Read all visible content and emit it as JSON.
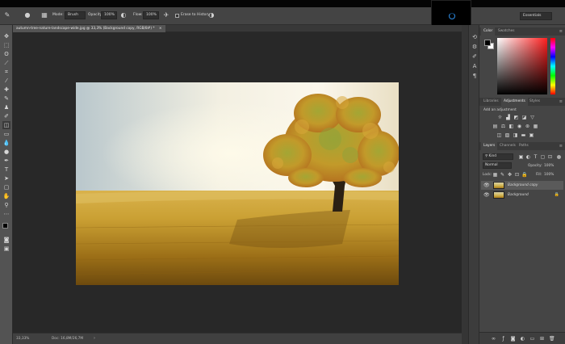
{
  "options_bar": {
    "mode_label": "Mode:",
    "mode_value": "Brush",
    "opacity_label": "Opacity:",
    "opacity_value": "100%",
    "flow_label": "Flow:",
    "flow_value": "100%",
    "erase_history_label": "Erase to History",
    "workspace_value": "Essentials"
  },
  "document": {
    "tab_title": "autumn-tree-nature-landscape-wide.jpg @ 33,3% (Background copy, RGB/8#) *",
    "tab_close": "×",
    "zoom_status": "33,33%",
    "doc_status": "Doc: 16,8M/26,7M"
  },
  "panels": {
    "color_tabs": [
      "Color",
      "Swatches"
    ],
    "lib_tabs": [
      "Libraries",
      "Adjustments",
      "Styles"
    ],
    "add_adjustment_label": "Add an adjustment",
    "layers_tabs": [
      "Layers",
      "Channels",
      "Paths"
    ],
    "kind_label": "Kind",
    "blend_mode": "Normal",
    "opacity_label": "Opacity:",
    "opacity_value": "100%",
    "lock_label": "Lock:",
    "fill_label": "Fill:",
    "fill_value": "100%",
    "layers": [
      {
        "name": "Background copy",
        "selected": true
      },
      {
        "name": "Background",
        "selected": false
      }
    ]
  },
  "colors": {
    "ui_dark": "#282828",
    "panel": "#454545",
    "selected_layer": "#5a5a5a",
    "accent_spinner": "#2f8fe8",
    "picker_hue": "#ff2020"
  },
  "icons": {
    "tools": [
      "move-icon",
      "marquee-icon",
      "lasso-icon",
      "quick-select-icon",
      "crop-icon",
      "eyedropper-icon",
      "healing-brush-icon",
      "brush-icon",
      "clone-stamp-icon",
      "history-brush-icon",
      "eraser-icon",
      "gradient-icon",
      "blur-icon",
      "dodge-icon",
      "pen-icon",
      "type-icon",
      "path-select-icon",
      "shape-icon",
      "hand-icon",
      "zoom-icon",
      "more-tools-icon"
    ],
    "layer_footer": [
      "link-icon",
      "fx-icon",
      "mask-icon",
      "adjustment-layer-icon",
      "group-icon",
      "new-layer-icon",
      "trash-icon"
    ]
  }
}
